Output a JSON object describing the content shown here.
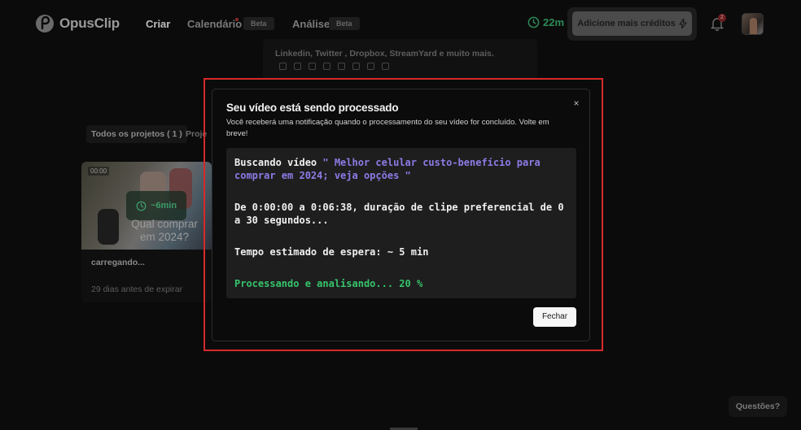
{
  "navbar": {
    "logo_text": "OpusClip",
    "items": [
      {
        "label": "Criar"
      },
      {
        "label": "Calendário",
        "badge": "Beta"
      },
      {
        "label": "Análise",
        "badge": "Beta"
      }
    ],
    "credits_time": "22m",
    "credits_button": "Adicione mais créditos",
    "notifications_count": "2"
  },
  "source": {
    "text": "Linkedin, Twitter , Dropbox, StreamYard e muito mais."
  },
  "projects": {
    "tabs": [
      "Todos os projetos ( 1 )",
      "Proje"
    ],
    "card": {
      "tag": "00:00",
      "overlay_time": "~6min",
      "caption": "Qual comprar em 2024?",
      "title": "carregando...",
      "expire": "29 dias antes de expirar"
    }
  },
  "help_button": "Questões?",
  "modal": {
    "title": "Seu vídeo está sendo processado",
    "subtitle": "Você receberá uma notificação quando o processamento do seu vídeo for concluído. Volte em breve!",
    "search_prefix": "Buscando vídeo ",
    "search_query": "\" Melhor celular custo-benefício para comprar em 2024; veja opções \"",
    "range_text": "De 0:00:00 a 0:06:38, duração de clipe preferencial de 0 a 30 segundos...",
    "wait_text": "Tempo estimado de espera: ~ 5 min",
    "progress_text": "Processando e analisando... 20 %",
    "progress_percent": 20,
    "close_button": "Fechar",
    "close_icon": "×"
  },
  "colors": {
    "highlight_border": "#d62a2a",
    "query_purple": "#8b7ce6",
    "progress_green": "#36c46b"
  }
}
